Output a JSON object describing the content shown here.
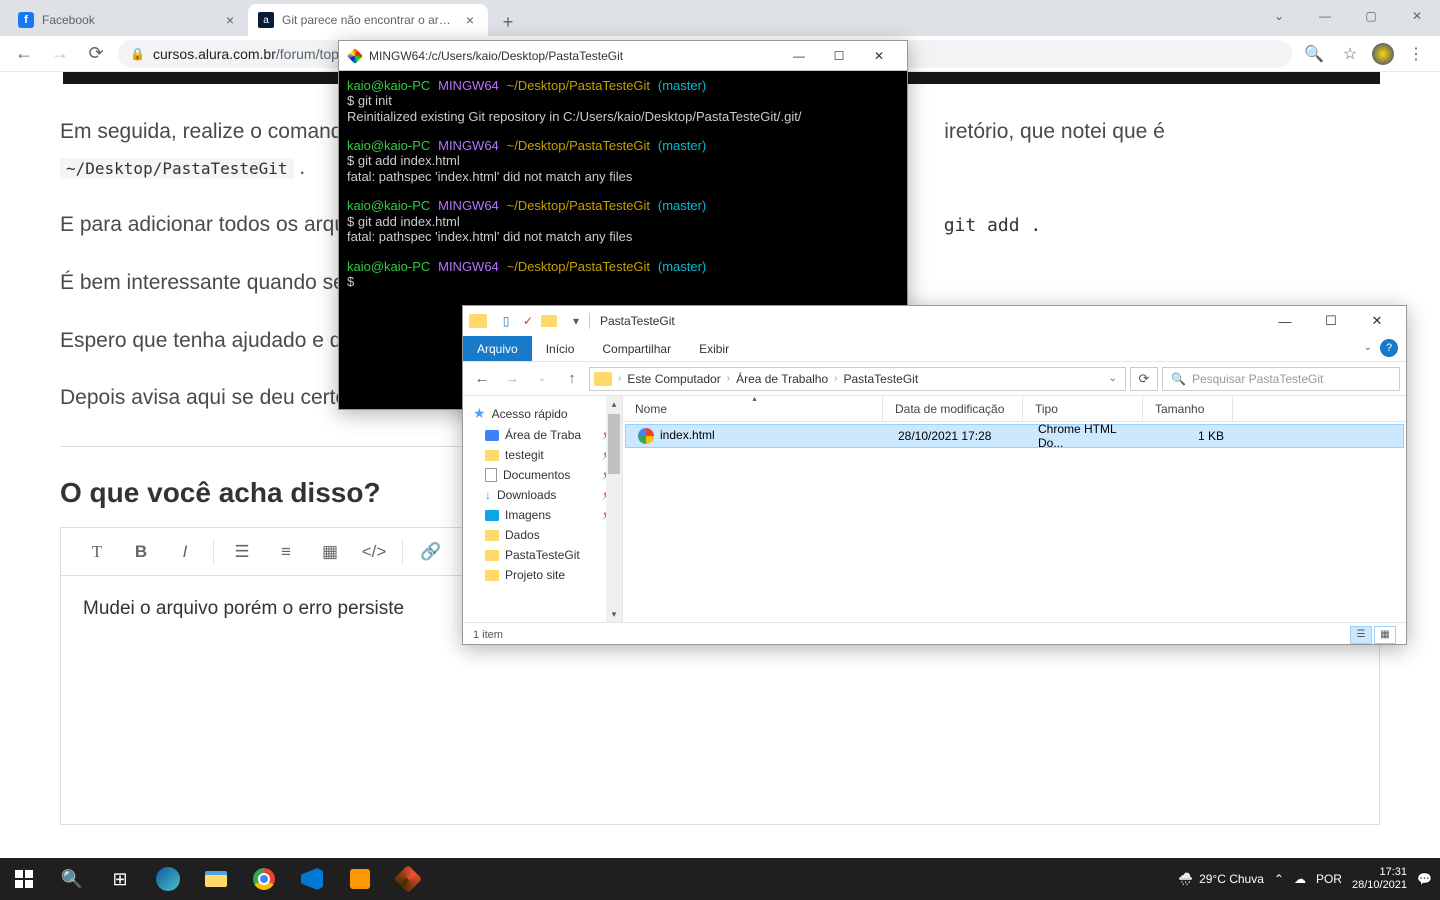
{
  "chrome": {
    "tabs": [
      {
        "title": "Facebook"
      },
      {
        "title": "Git parece não encontrar o arqui"
      }
    ],
    "url_host": "cursos.alura.com.br",
    "url_path": "/forum/topic"
  },
  "page": {
    "p1a": "Em seguida, realize o comand",
    "p1b": "iretório, que notei que é",
    "code1": "~/Desktop/PastaTesteGit",
    "p2": "E para adicionar todos os arqu",
    "code2": "git add .",
    "p3": "É bem interessante quando se",
    "p4": "Espero que tenha ajudado e q",
    "p5": "Depois avisa aqui se deu certo",
    "heading": "O que você acha disso?",
    "editor_text": "Mudei o arquivo porém o erro persiste"
  },
  "terminal": {
    "title": "MINGW64:/c/Users/kaio/Desktop/PastaTesteGit",
    "user": "kaio@kaio-PC",
    "host": "MINGW64",
    "path": "~/Desktop/PastaTesteGit",
    "branch": "(master)",
    "l1": "$ git init",
    "l2": "Reinitialized existing Git repository in C:/Users/kaio/Desktop/PastaTesteGit/.git/",
    "l3": "$ git add index.html",
    "l4": "fatal: pathspec 'index.html' did not match any files",
    "l5": "$ git add index.html",
    "l6": "fatal: pathspec 'index.html' did not match any files",
    "l7": "$ "
  },
  "explorer": {
    "title": "PastaTesteGit",
    "menu": {
      "file": "Arquivo",
      "home": "Início",
      "share": "Compartilhar",
      "view": "Exibir"
    },
    "breadcrumb": [
      "Este Computador",
      "Área de Trabalho",
      "PastaTesteGit"
    ],
    "search_placeholder": "Pesquisar PastaTesteGit",
    "sidebar": {
      "quick": "Acesso rápido",
      "items": [
        "Área de Traba",
        "testegit",
        "Documentos",
        "Downloads",
        "Imagens",
        "Dados",
        "PastaTesteGit",
        "Projeto site"
      ]
    },
    "columns": {
      "name": "Nome",
      "date": "Data de modificação",
      "type": "Tipo",
      "size": "Tamanho"
    },
    "file": {
      "name": "index.html",
      "date": "28/10/2021 17:28",
      "type": "Chrome HTML Do...",
      "size": "1 KB"
    },
    "status": "1 item"
  },
  "taskbar": {
    "weather": "29°C  Chuva",
    "lang": "POR",
    "time": "17:31",
    "date": "28/10/2021"
  }
}
